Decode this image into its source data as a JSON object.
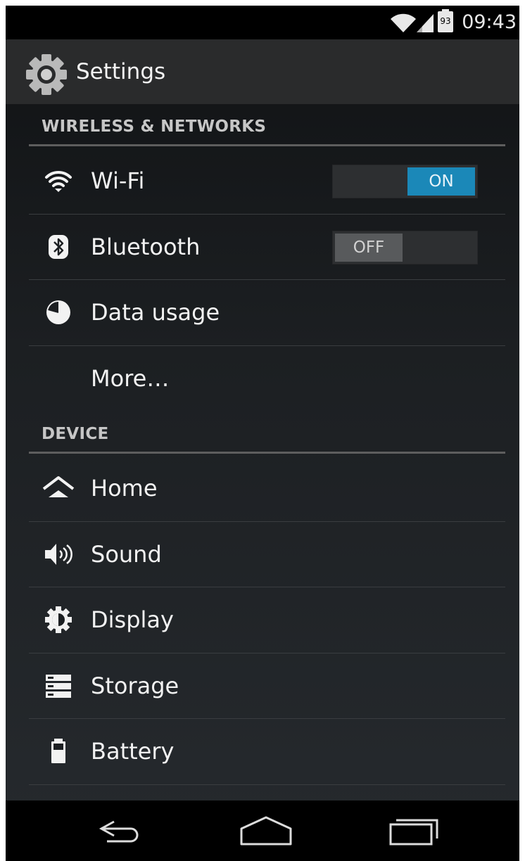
{
  "status_bar": {
    "time": "09:43",
    "battery_level": "93",
    "icons": [
      "wifi-icon",
      "cell-signal-icon",
      "battery-icon"
    ]
  },
  "action_bar": {
    "icon": "settings-gear-icon",
    "title": "Settings"
  },
  "sections": {
    "wireless": {
      "header": "WIRELESS & NETWORKS",
      "items": [
        {
          "label": "Wi-Fi",
          "icon": "wifi-icon",
          "toggle": "ON"
        },
        {
          "label": "Bluetooth",
          "icon": "bluetooth-icon",
          "toggle": "OFF"
        },
        {
          "label": "Data usage",
          "icon": "data-usage-icon"
        },
        {
          "label": "More…"
        }
      ]
    },
    "device": {
      "header": "DEVICE",
      "items": [
        {
          "label": "Home",
          "icon": "home-icon"
        },
        {
          "label": "Sound",
          "icon": "sound-icon"
        },
        {
          "label": "Display",
          "icon": "display-icon"
        },
        {
          "label": "Storage",
          "icon": "storage-icon"
        },
        {
          "label": "Battery",
          "icon": "battery-icon"
        }
      ]
    }
  },
  "nav_bar": {
    "buttons": [
      "back-icon",
      "home-nav-icon",
      "recents-icon"
    ]
  },
  "colors": {
    "accent": "#1b88b8",
    "background": "#1c1f22",
    "text": "#f2f2f2",
    "section_header": "#c6c6c6"
  }
}
